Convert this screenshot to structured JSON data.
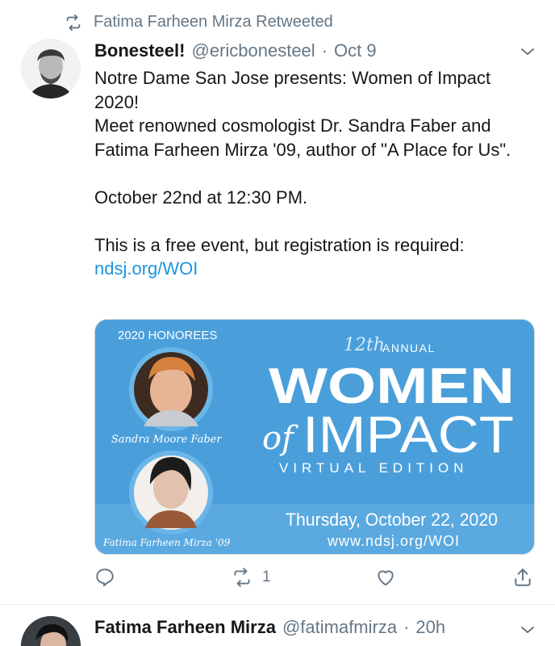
{
  "retweet": {
    "icon": "retweet-icon",
    "text": "Fatima Farheen Mirza Retweeted"
  },
  "tweet": {
    "author_name": "Bonesteel!",
    "author_handle": "@ericbonesteel",
    "separator": "·",
    "date": "Oct 9",
    "text_lines": [
      "Notre Dame San Jose presents: Women of Impact 2020!",
      "Meet renowned cosmologist Dr. Sandra Faber and Fatima Farheen Mirza '09, author of \"A Place for Us\".",
      "October 22nd at 12:30 PM.",
      "This is a free event, but registration is required:",
      "ndsj.org/WOI"
    ],
    "card": {
      "honorees_label": "2020 HONOREES",
      "annual_number": "12th",
      "annual_label": "ANNUAL",
      "headline_1": "WOMEN",
      "headline_of": "of",
      "headline_2": "IMPACT",
      "edition": "VIRTUAL EDITION",
      "honoree_1": "Sandra Moore Faber",
      "honoree_2": "Fatima Farheen Mirza '09",
      "event_date": "Thursday, October 22, 2020",
      "event_url": "www.ndsj.org/WOI"
    },
    "actions": {
      "reply_icon": "reply-icon",
      "retweet_icon": "retweet-icon",
      "retweet_count": "1",
      "like_icon": "heart-icon",
      "share_icon": "share-icon"
    }
  },
  "next_tweet": {
    "author_name": "Fatima Farheen Mirza",
    "author_handle": "@fatimafmirza",
    "separator": "·",
    "date": "20h"
  },
  "colors": {
    "text": "#14171a",
    "secondary": "#657786",
    "link": "#1b95e0",
    "card_blue": "#4a9fdb"
  }
}
